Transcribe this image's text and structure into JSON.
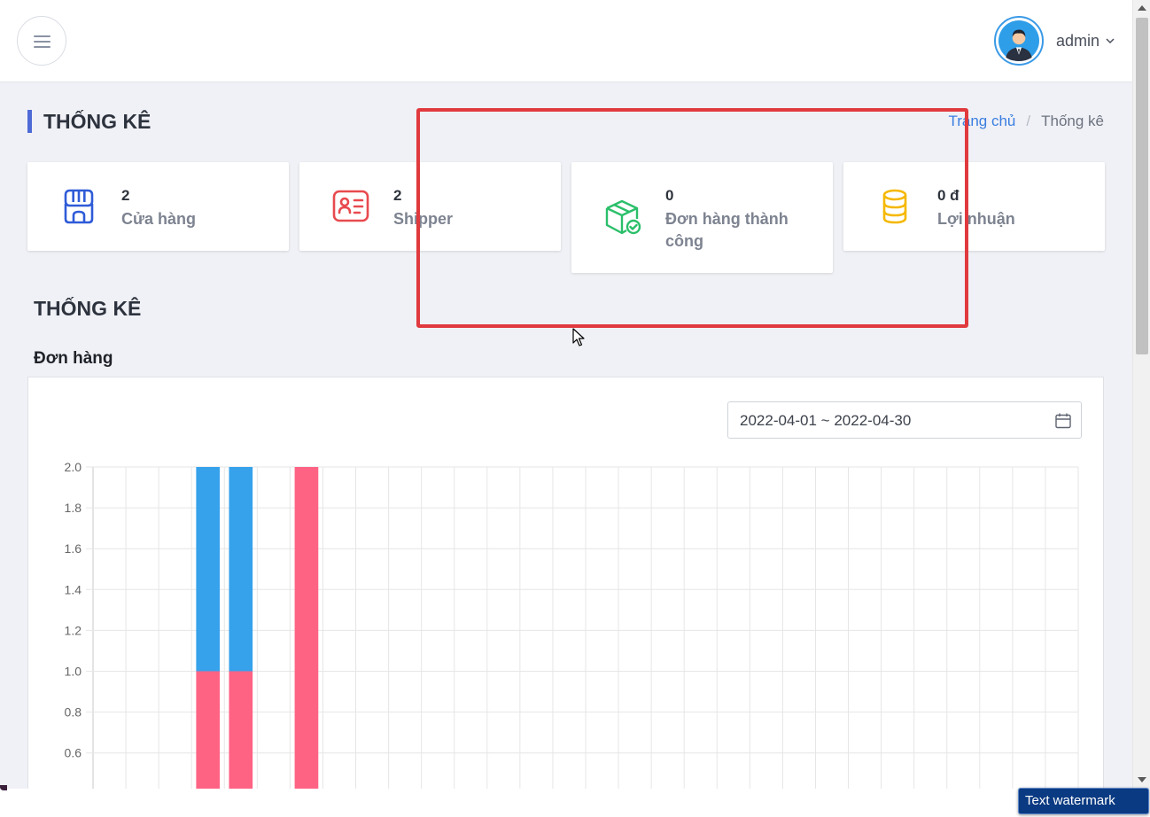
{
  "header": {
    "username": "admin"
  },
  "page": {
    "title": "THỐNG KÊ",
    "breadcrumb": {
      "home": "Trang chủ",
      "separator": "/",
      "current": "Thống kê"
    }
  },
  "stats": [
    {
      "value": "2",
      "label": "Cửa hàng",
      "icon": "store-icon",
      "color": "#2f5bd8"
    },
    {
      "value": "2",
      "label": "Shipper",
      "icon": "id-card-icon",
      "color": "#e84a4f"
    },
    {
      "value": "0",
      "label": "Đơn hàng thành công",
      "icon": "package-check-icon",
      "color": "#2bbf6a"
    },
    {
      "value": "0 đ",
      "label": "Lợi nhuận",
      "icon": "coins-icon",
      "color": "#f5b800"
    }
  ],
  "section": {
    "title": "THỐNG KÊ",
    "subtitle": "Đơn hàng"
  },
  "filter": {
    "date_range": "2022-04-01 ~ 2022-04-30"
  },
  "chart_data": {
    "type": "bar",
    "stacked": true,
    "days": 30,
    "ylim": [
      0.6,
      2.0
    ],
    "yticks": [
      "2.0",
      "1.8",
      "1.6",
      "1.4",
      "1.2",
      "1.0",
      "0.8",
      "0.6"
    ],
    "grid": true,
    "series": [
      {
        "color": "#ff6384",
        "values": [
          0,
          0,
          0,
          1,
          1,
          0,
          2,
          0,
          0,
          0,
          0,
          0,
          0,
          0,
          0,
          0,
          0,
          0,
          0,
          0,
          0,
          0,
          0,
          0,
          0,
          0,
          0,
          0,
          0,
          0
        ]
      },
      {
        "color": "#36a2eb",
        "values": [
          0,
          0,
          0,
          1,
          1,
          0,
          0,
          0,
          0,
          0,
          0,
          0,
          0,
          0,
          0,
          0,
          0,
          0,
          0,
          0,
          0,
          0,
          0,
          0,
          0,
          0,
          0,
          0,
          0,
          0
        ]
      }
    ]
  },
  "watermark": "Text watermark"
}
